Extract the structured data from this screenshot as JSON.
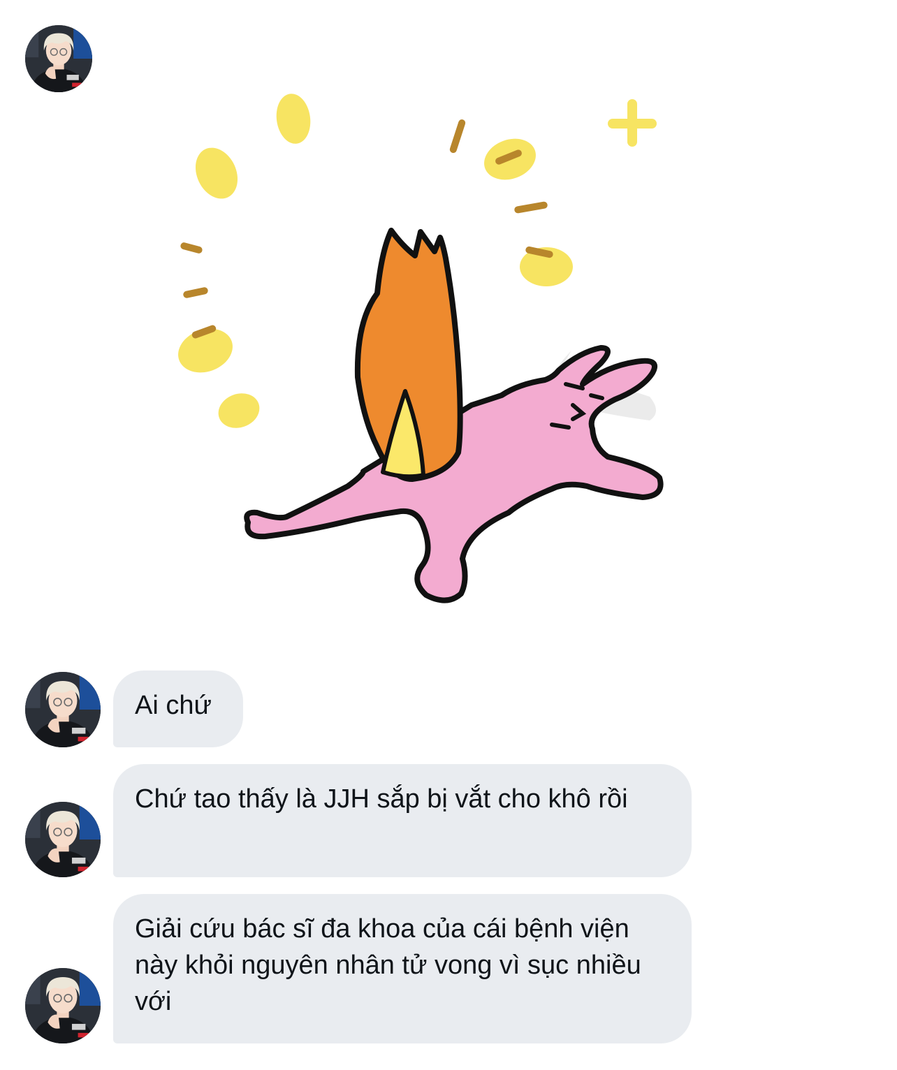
{
  "conversation": {
    "sender_avatar_icon": "user-avatar-icon",
    "sticker": {
      "icon": "pink-rabbit-flame-sticker",
      "colors": {
        "flame": "#ee8a2e",
        "flame_inner": "#fbe86a",
        "body": "#f3abd0",
        "sparkle": "#f7e35a",
        "outline": "#111111"
      }
    },
    "messages": [
      {
        "text": "Ai chứ"
      },
      {
        "text": "Chứ tao thấy là JJH sắp bị vắt cho khô rồi"
      },
      {
        "text": "Giải cứu bác sĩ đa khoa của cái bệnh viện này khỏi nguyên nhân tử vong vì sục nhiều với"
      }
    ]
  },
  "theme": {
    "bubble_bg": "#e9ecf0",
    "text_color": "#0f1419",
    "page_bg": "#ffffff"
  }
}
